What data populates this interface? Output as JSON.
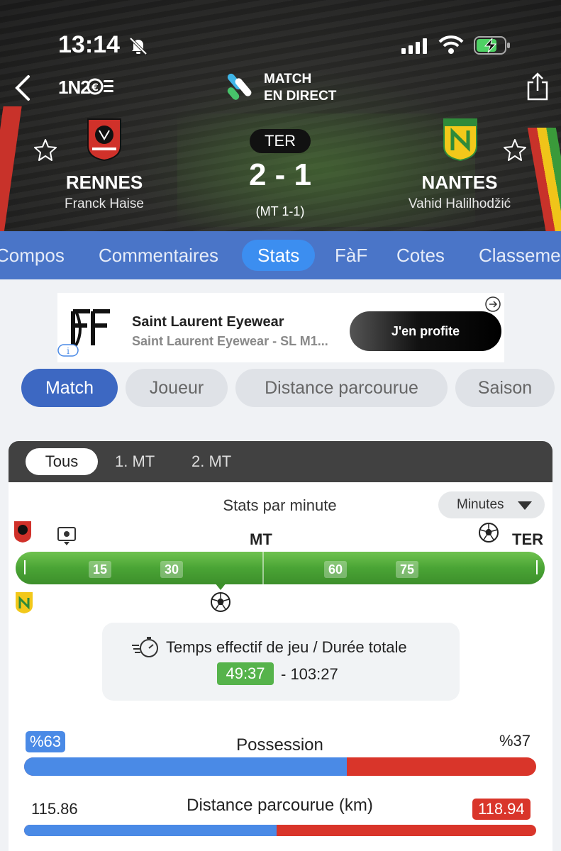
{
  "status_bar": {
    "time": "13:14"
  },
  "header": {
    "brand": "1N2",
    "live_line1": "MATCH",
    "live_line2": "EN DIRECT",
    "match_status": "TER",
    "score": "2 - 1",
    "halftime": "(MT 1-1)",
    "home": {
      "name": "RENNES",
      "coach": "Franck Haise",
      "color": "#c8322a"
    },
    "away": {
      "name": "NANTES",
      "coach": "Vahid Halilhodžić",
      "color": "#f0c419"
    }
  },
  "tabs": [
    {
      "label": "Compos"
    },
    {
      "label": "Commentaires"
    },
    {
      "label": "Stats",
      "active": true
    },
    {
      "label": "FàF"
    },
    {
      "label": "Cotes"
    },
    {
      "label": "Classement"
    }
  ],
  "ad": {
    "title": "Saint Laurent Eyewear",
    "subtitle": "Saint Laurent Eyewear - SL M1...",
    "cta": "J'en profite"
  },
  "chips": [
    {
      "label": "Match",
      "active": true
    },
    {
      "label": "Joueur"
    },
    {
      "label": "Distance parcourue"
    },
    {
      "label": "Saison"
    }
  ],
  "periods": [
    {
      "label": "Tous",
      "active": true
    },
    {
      "label": "1. MT"
    },
    {
      "label": "2. MT"
    }
  ],
  "timeline": {
    "title": "Stats par minute",
    "dropdown": "Minutes",
    "halftime_label": "MT",
    "end_label": "TER",
    "ticks": [
      "15",
      "30",
      "60",
      "75"
    ],
    "home_events": [
      "var-icon",
      "goal-icon"
    ],
    "away_events": [
      "goal-icon"
    ]
  },
  "effective_time": {
    "title": "Temps effectif de jeu / Durée totale",
    "effective": "49:37",
    "total": "- 103:27"
  },
  "stats": [
    {
      "title": "Possession",
      "home": "%63",
      "away": "%37",
      "home_share": 0.63,
      "highlight": "home"
    },
    {
      "title": "Distance parcourue (km)",
      "home": "115.86",
      "away": "118.94",
      "home_share": 0.493,
      "highlight": "away"
    }
  ],
  "colors": {
    "tab_bar": "#4a75c8",
    "active_chip": "#3d68c2",
    "home_bar": "#4a8ae6",
    "away_bar": "#d9352a",
    "timeline": "#4aa435"
  }
}
